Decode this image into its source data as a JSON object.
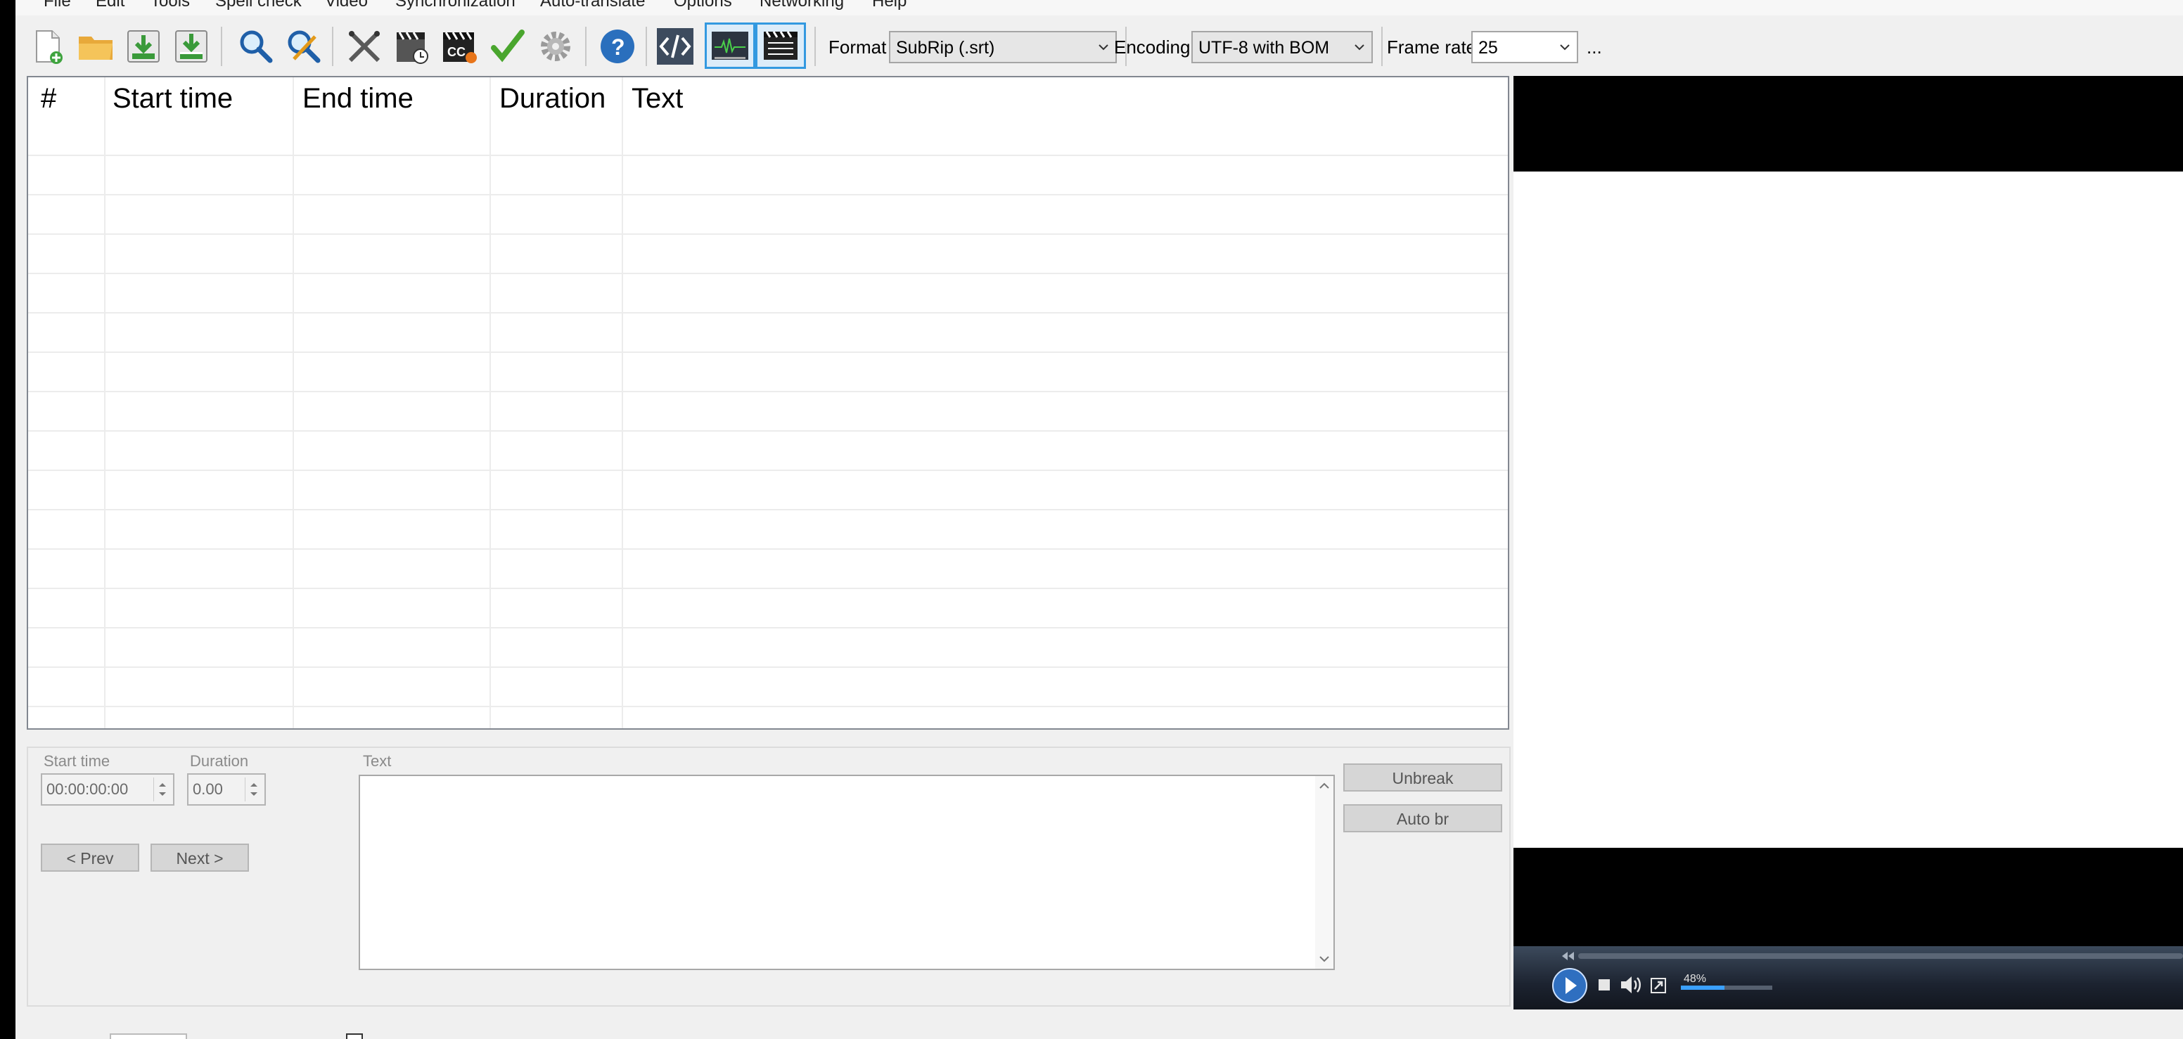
{
  "menu": {
    "file": "File",
    "edit": "Edit",
    "tools": "Tools",
    "spell_check": "Spell check",
    "video": "Video",
    "synchronization": "Synchronization",
    "auto_translate": "Auto-translate",
    "options": "Options",
    "networking": "Networking",
    "help": "Help"
  },
  "toolbar": {
    "format_label": "Format",
    "format_value": "SubRip (.srt)",
    "encoding_label": "Encoding",
    "encoding_value": "UTF-8 with BOM",
    "framerate_label": "Frame rate",
    "framerate_value": "25",
    "more": "..."
  },
  "grid": {
    "columns": [
      "#",
      "Start time",
      "End time",
      "Duration",
      "Text"
    ],
    "rows": []
  },
  "edit": {
    "start_time_label": "Start time",
    "start_time_value": "00:00:00:00",
    "duration_label": "Duration",
    "duration_value": "0.00",
    "text_label": "Text",
    "prev": "< Prev",
    "next": "Next >",
    "unbreak": "Unbreak",
    "auto_br": "Auto br"
  },
  "player": {
    "volume": "48%",
    "volume_level": 0.48
  },
  "icons": [
    "new-file-icon",
    "open-folder-icon",
    "save-icon",
    "save-as-icon",
    "find-icon",
    "replace-icon",
    "visual-sync-icon",
    "fix-common-errors-icon",
    "burn-in-icon",
    "spell-check-icon",
    "settings-icon",
    "help-icon",
    "source-view-icon",
    "waveform-icon",
    "video-player-icon"
  ]
}
